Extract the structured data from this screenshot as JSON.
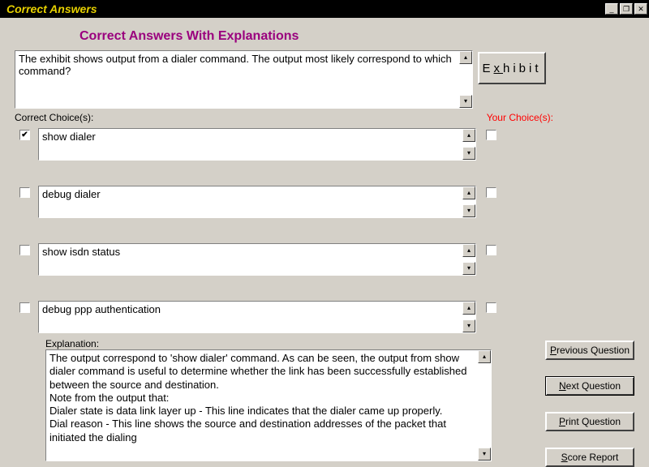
{
  "title": "Correct Answers",
  "subtitle": "Correct Answers With Explanations",
  "question": "The exhibit shows output from a dialer command. The output most likely correspond to which command?",
  "exhibit_btn": {
    "pre": "E",
    "u": "x",
    "post": "hibit"
  },
  "labels": {
    "correct": "Correct Choice(s):",
    "your": "Your Choice(s):"
  },
  "choices": [
    {
      "text": "show dialer",
      "correct": true,
      "your": false
    },
    {
      "text": "debug dialer",
      "correct": false,
      "your": false
    },
    {
      "text": "show isdn status",
      "correct": false,
      "your": false
    },
    {
      "text": "debug ppp authentication",
      "correct": false,
      "your": false
    }
  ],
  "explanation_label": "Explanation:",
  "explanation": "The output correspond to 'show dialer' command. As can be seen, the output from show dialer command is useful to determine whether the link has been successfully established between the source and destination.\nNote from the output that:\nDialer state is data link layer up - This line indicates that the dialer came up properly.\nDial reason -  This line shows the source and destination addresses of the packet that initiated the dialing",
  "buttons": {
    "prev": {
      "u": "P",
      "rest": "revious Question"
    },
    "next": {
      "u": "N",
      "rest": "ext Question"
    },
    "print": {
      "u": "P",
      "rest": "rint Question"
    },
    "score": {
      "u": "S",
      "rest": "core Report"
    }
  },
  "glyphs": {
    "up": "▴",
    "down": "▾",
    "check": "✔",
    "min": "_",
    "rest": "❐",
    "close": "✕"
  }
}
